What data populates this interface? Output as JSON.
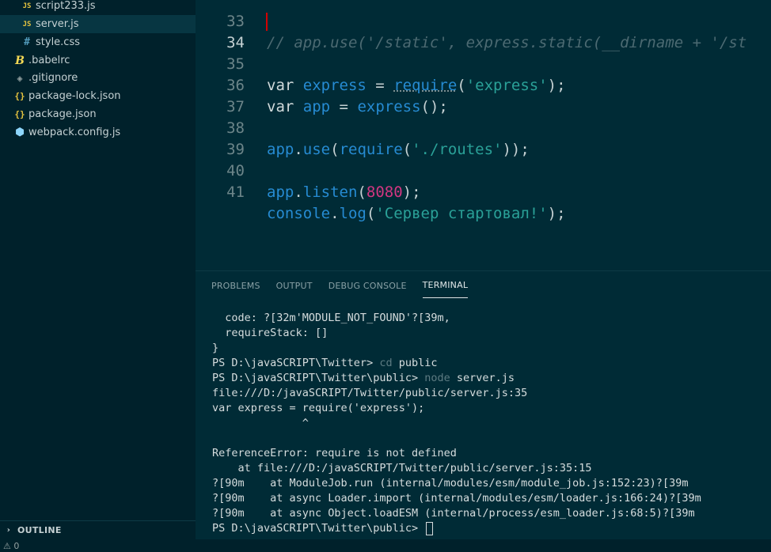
{
  "sidebar": {
    "files": [
      {
        "name": "script233.js",
        "icon": "js-file-icon",
        "glyph": "JS"
      },
      {
        "name": "server.js",
        "icon": "js-file-icon",
        "glyph": "JS",
        "selected": true
      },
      {
        "name": "style.css",
        "icon": "css-file-icon",
        "glyph": "#"
      },
      {
        "name": ".babelrc",
        "icon": "babel-file-icon",
        "glyph": "B"
      },
      {
        "name": ".gitignore",
        "icon": "git-file-icon",
        "glyph": "◈"
      },
      {
        "name": "package-lock.json",
        "icon": "json-file-icon",
        "glyph": "{}"
      },
      {
        "name": "package.json",
        "icon": "json-file-icon",
        "glyph": "{}"
      },
      {
        "name": "webpack.config.js",
        "icon": "webpack-file-icon",
        "glyph": "⬢"
      }
    ],
    "outline_label": "OUTLINE"
  },
  "statusbar": {
    "text": "⚠ 0"
  },
  "editor": {
    "line_numbers": [
      "33",
      "34",
      "35",
      "36",
      "37",
      "38",
      "39",
      "40",
      "41"
    ],
    "comment_line": "// app.use('/static', express.static(__dirname + '/st",
    "line35": {
      "kw": "var",
      "name": "express",
      "eq": " = ",
      "fn": "require",
      "open": "(",
      "str": "'express'",
      "close": ");"
    },
    "line36": {
      "kw": "var",
      "name": "app",
      "eq": " = ",
      "fn": "express",
      "close": "();"
    },
    "line38": {
      "obj": "app",
      "dot": ".",
      "fn": "use",
      "open": "(",
      "fn2": "require",
      "open2": "(",
      "str": "'./routes'",
      "close": "));"
    },
    "line40": {
      "obj": "app",
      "dot": ".",
      "fn": "listen",
      "open": "(",
      "num": "8080",
      "close": ");"
    },
    "line41": {
      "obj": "console",
      "dot": ".",
      "fn": "log",
      "open": "(",
      "str": "'Сервер стартовал!'",
      "close": ");"
    }
  },
  "panel": {
    "tabs": [
      "PROBLEMS",
      "OUTPUT",
      "DEBUG CONSOLE",
      "TERMINAL"
    ],
    "active_tab": "TERMINAL"
  },
  "terminal": {
    "lines": [
      "  code: ?[32m'MODULE_NOT_FOUND'?[39m,",
      "  requireStack: []",
      "}",
      "",
      "",
      "file:///D:/javaSCRIPT/Twitter/public/server.js:35",
      "var express = require('express');",
      "              ^",
      "",
      "ReferenceError: require is not defined",
      "    at file:///D:/javaSCRIPT/Twitter/public/server.js:35:15",
      "?[90m    at ModuleJob.run (internal/modules/esm/module_job.js:152:23)?[39m",
      "?[90m    at async Loader.import (internal/modules/esm/loader.js:166:24)?[39m",
      "?[90m    at async Object.loadESM (internal/process/esm_loader.js:68:5)?[39m"
    ],
    "cmd1": {
      "prompt": "PS D:\\javaSCRIPT\\Twitter> ",
      "cmd": "cd",
      "arg": " public"
    },
    "cmd2": {
      "prompt": "PS D:\\javaSCRIPT\\Twitter\\public> ",
      "cmd": "node",
      "arg": " server.js"
    },
    "final_prompt": "PS D:\\javaSCRIPT\\Twitter\\public> "
  }
}
